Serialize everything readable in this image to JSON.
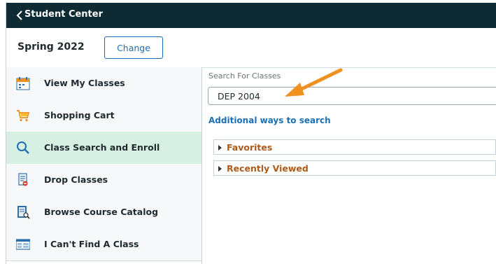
{
  "header": {
    "back_label": "Student Center"
  },
  "term": {
    "name": "Spring 2022",
    "change_label": "Change"
  },
  "sidebar": {
    "items": [
      {
        "label": "View My Classes",
        "icon": "calendar-icon"
      },
      {
        "label": "Shopping Cart",
        "icon": "shopping-cart-icon"
      },
      {
        "label": "Class Search and Enroll",
        "icon": "search-icon",
        "active": true
      },
      {
        "label": "Drop Classes",
        "icon": "drop-document-icon"
      },
      {
        "label": "Browse Course Catalog",
        "icon": "catalog-search-icon"
      },
      {
        "label": "I Can't Find A Class",
        "icon": "class-list-icon"
      }
    ]
  },
  "search": {
    "label": "Search For Classes",
    "value": "DEP 2004",
    "additional_link": "Additional ways to search"
  },
  "sections": [
    {
      "label": "Favorites"
    },
    {
      "label": "Recently Viewed"
    }
  ],
  "colors": {
    "topbar": "#0e2a33",
    "accent": "#1b6fb5",
    "active_item": "#d8efe3",
    "section_text": "#b05a19",
    "annotation_arrow": "#f0901e"
  }
}
